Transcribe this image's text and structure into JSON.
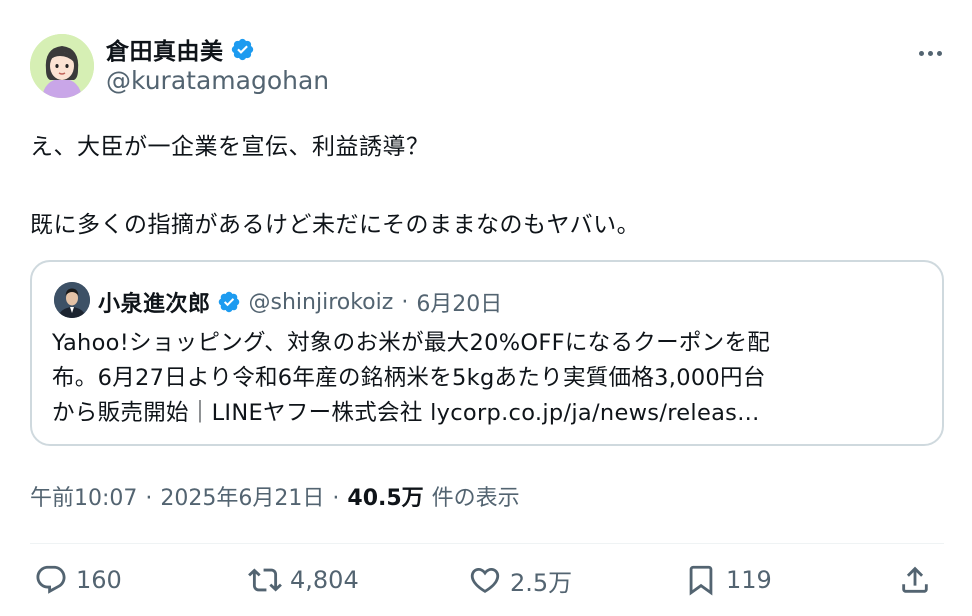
{
  "author": {
    "name": "倉田真由美",
    "handle": "@kuratamagohan",
    "verified": true
  },
  "tweet_text": {
    "line1": "え、大臣が一企業を宣伝、利益誘導？",
    "line2": "既に多くの指摘があるけど未だにそのままなのもヤバい。"
  },
  "quote": {
    "name": "小泉進次郎",
    "handle": "@shinjirokoiz",
    "separator": "·",
    "date": "6月20日",
    "lines": [
      "Yahoo!ショッピング、対象のお米が最大20%OFFになるクーポンを配",
      "布。6月27日より令和6年産の銘柄米を5kgあたり実質価格3,000円台",
      "から販売開始｜LINEヤフー株式会社 lycorp.co.jp/ja/news/releas..."
    ]
  },
  "meta": {
    "time": "午前10:07",
    "separator": "·",
    "date": "2025年6月21日",
    "views": "40.5万",
    "views_label": "件の表示"
  },
  "actions": {
    "reply_count": "160",
    "retweet_count": "4,804",
    "like_count": "2.5万",
    "bookmark_count": "119"
  },
  "colors": {
    "verified": "#1d9bf0",
    "secondary_text": "#536471",
    "border": "#cfd9de",
    "avatar_bg": "#d6efb4"
  },
  "icons": {
    "more": "more-dots-icon",
    "verified": "verified-badge-icon",
    "reply": "reply-icon",
    "retweet": "retweet-icon",
    "like": "heart-icon",
    "bookmark": "bookmark-icon",
    "share": "share-icon"
  }
}
